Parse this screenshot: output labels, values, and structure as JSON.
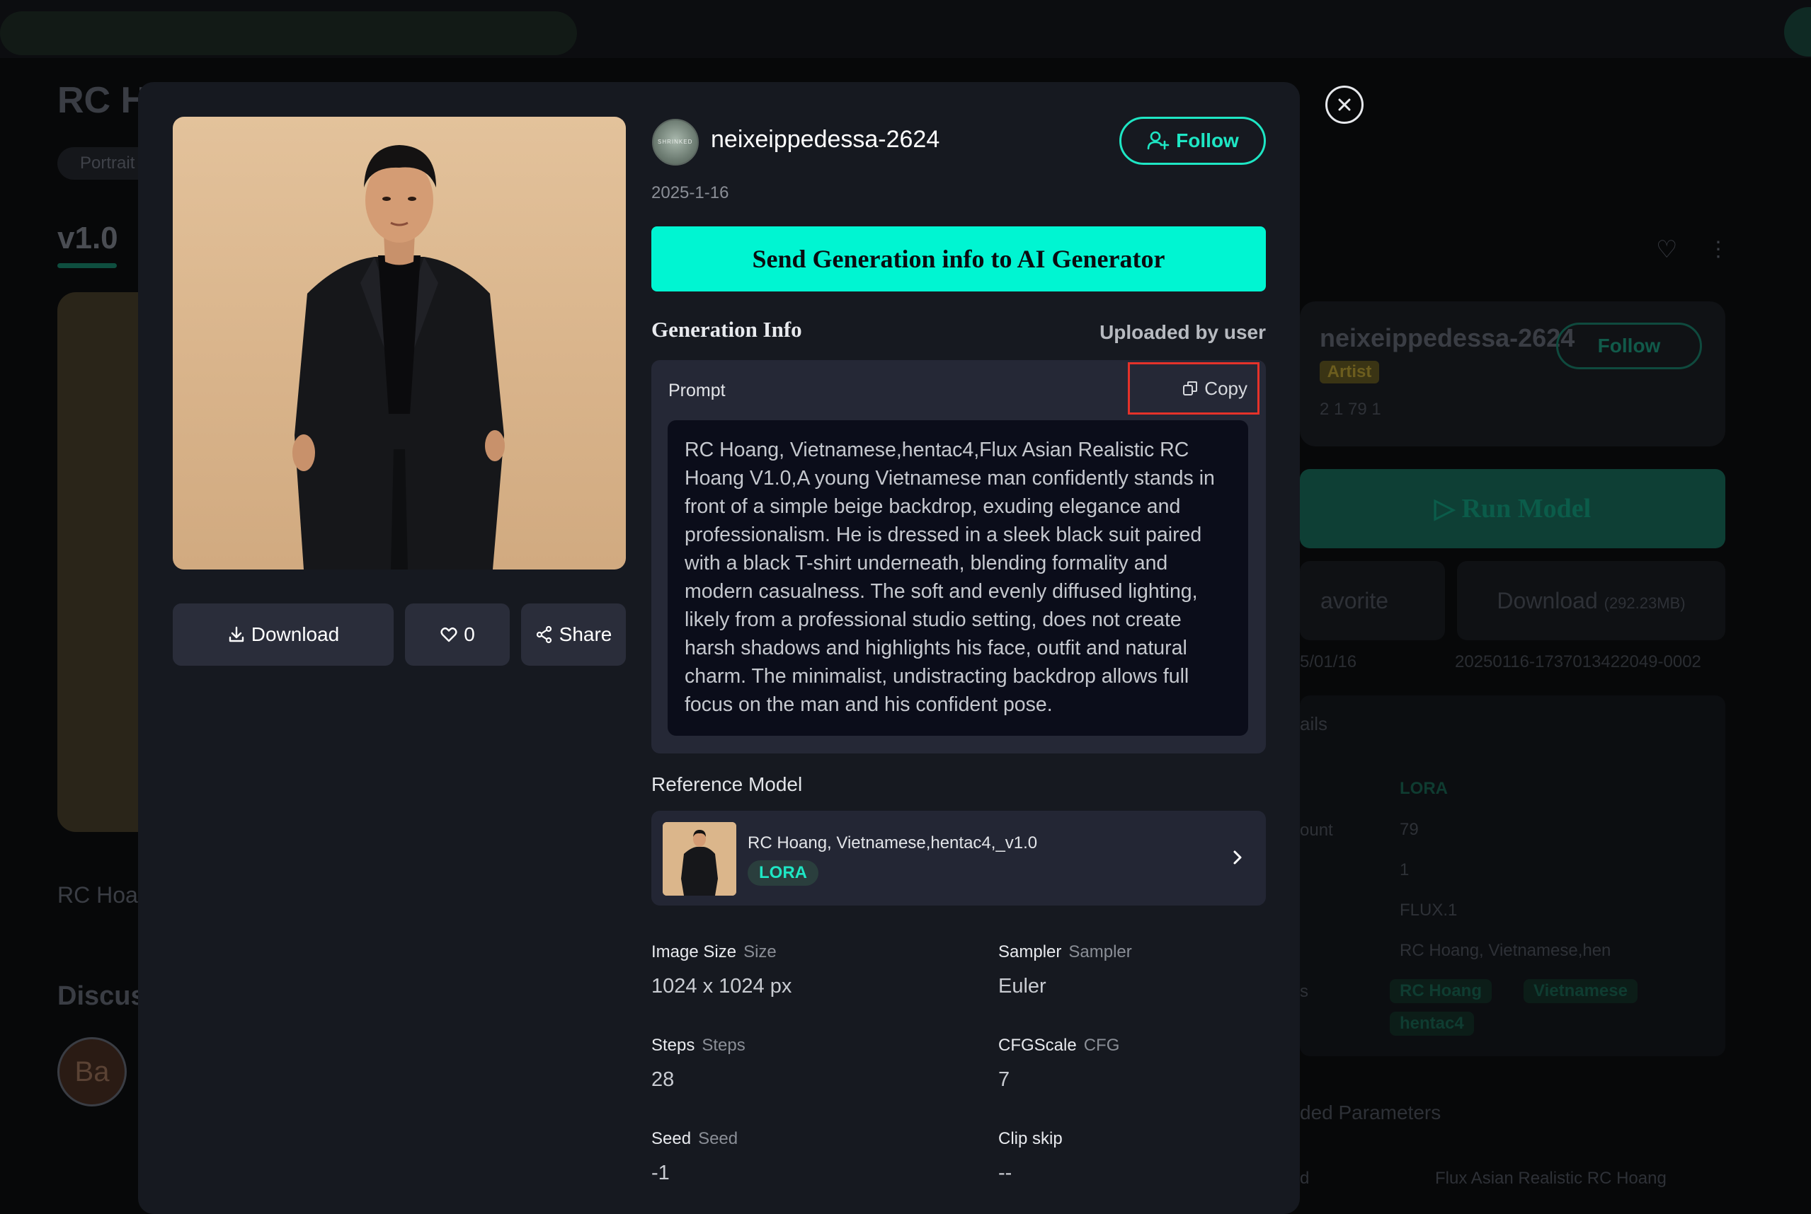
{
  "background": {
    "page_title": "RC H",
    "pill": "Portrait",
    "version": "v1.0",
    "subtitle": "RC Hoa",
    "discussion": "Discus",
    "avatar_initials": "Ba",
    "artist": {
      "name": "neixeippedessa-2624",
      "badge": "Artist",
      "follow": "Follow",
      "stats": "2  1  79  1"
    },
    "run_model": "Run Model",
    "favorite": "avorite",
    "download": "Download",
    "download_size": "(292.23MB)",
    "date": "5/01/16",
    "file_id": "20250116-1737013422049-0002",
    "details_label": "ails",
    "details_count_label": "ount",
    "details_s": "s",
    "details_values": [
      "LORA",
      "79",
      "1",
      "FLUX.1",
      "RC Hoang, Vietnamese,hen"
    ],
    "tags": [
      "RC Hoang",
      "Vietnamese",
      "hentac4"
    ],
    "advanced": "ded Parameters",
    "adv_item": "Flux Asian Realistic RC Hoang",
    "adv_d": "d"
  },
  "modal": {
    "username": "neixeippedessa-2624",
    "avatar_text": "SHRINKED",
    "follow_label": "Follow",
    "date": "2025-1-16",
    "send_button": "Send Generation info to AI Generator",
    "gen_info_title": "Generation Info",
    "uploaded_by": "Uploaded by user",
    "prompt_label": "Prompt",
    "copy_label": "Copy",
    "prompt_text": "RC Hoang, Vietnamese,hentac4,Flux Asian Realistic RC Hoang V1.0,A young Vietnamese man confidently stands in front of a simple beige backdrop, exuding elegance and professionalism. He is dressed in a sleek black suit paired with a black T-shirt underneath, blending formality and modern casualness. The soft and evenly diffused lighting, likely from a professional studio setting, does not create harsh shadows and highlights his face, outfit and natural charm. The minimalist, undistracting backdrop allows full focus on the man and his confident pose.",
    "actions": {
      "download": "Download",
      "likes": "0",
      "share": "Share"
    },
    "reference_label": "Reference Model",
    "reference": {
      "title": "RC Hoang, Vietnamese,hentac4,_v1.0",
      "badge": "LORA"
    },
    "params": [
      {
        "label": "Image Size",
        "sub": "Size",
        "value": "1024 x 1024 px"
      },
      {
        "label": "Sampler",
        "sub": "Sampler",
        "value": "Euler"
      },
      {
        "label": "Steps",
        "sub": "Steps",
        "value": "28"
      },
      {
        "label": "CFGScale",
        "sub": "CFG",
        "value": "7"
      },
      {
        "label": "Seed",
        "sub": "Seed",
        "value": "-1"
      },
      {
        "label": "Clip skip",
        "sub": "",
        "value": "--"
      }
    ]
  },
  "colors": {
    "accent": "#00f5d2",
    "follow": "#1ee6c4",
    "highlight_box": "#e5322a",
    "modal_bg": "#161920"
  },
  "icons": [
    "close-icon",
    "user-plus-icon",
    "copy-icon",
    "download-icon",
    "heart-icon",
    "share-icon",
    "chevron-right-icon"
  ]
}
